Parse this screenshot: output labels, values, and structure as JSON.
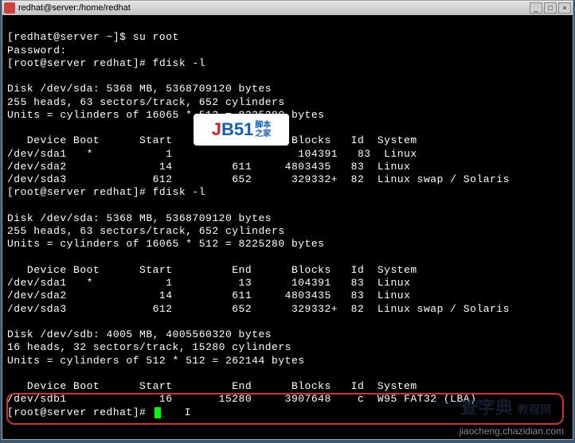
{
  "titlebar": {
    "title": "redhat@server:/home/redhat"
  },
  "lines": {
    "l1": "[redhat@server ~]$ su root",
    "l2": "Password:",
    "l3": "[root@server redhat]# fdisk -l",
    "l4": "",
    "l5": "Disk /dev/sda: 5368 MB, 5368709120 bytes",
    "l6": "255 heads, 63 sectors/track, 652 cylinders",
    "l7": "Units = cylinders of 16065 * 512 = 8225280 bytes",
    "l8": "",
    "l9": "   Device Boot      Start         End      Blocks   Id  System",
    "l10": "/dev/sda1   *           1                   104391   83  Linux",
    "l11": "/dev/sda2              14         611     4803435   83  Linux",
    "l12": "/dev/sda3             612         652      329332+  82  Linux swap / Solaris",
    "l13": "[root@server redhat]# fdisk -l",
    "l14": "",
    "l15": "Disk /dev/sda: 5368 MB, 5368709120 bytes",
    "l16": "255 heads, 63 sectors/track, 652 cylinders",
    "l17": "Units = cylinders of 16065 * 512 = 8225280 bytes",
    "l18": "",
    "l19": "   Device Boot      Start         End      Blocks   Id  System",
    "l20": "/dev/sda1   *           1          13      104391   83  Linux",
    "l21": "/dev/sda2              14         611     4803435   83  Linux",
    "l22": "/dev/sda3             612         652      329332+  82  Linux swap / Solaris",
    "l23": "",
    "l24": "Disk /dev/sdb: 4005 MB, 4005560320 bytes",
    "l25": "16 heads, 32 sectors/track, 15280 cylinders",
    "l26": "Units = cylinders of 512 * 512 = 262144 bytes",
    "l27": "",
    "l28": "   Device Boot      Start         End      Blocks   Id  System",
    "l29": "/dev/sdb1              16       15280     3907648    c  W95 FAT32 (LBA)",
    "l30": "[root@server redhat]# "
  },
  "logo": {
    "text_j": "J",
    "text_b": "B51",
    "cn_top": "脚本",
    "cn_bot": "之家",
    "url": "www.jb51.net"
  },
  "watermarks": {
    "w1": "查字典",
    "w1b": "教程网",
    "w2": "jiaocheng.chazidian.com",
    "w3": "blue1000"
  }
}
